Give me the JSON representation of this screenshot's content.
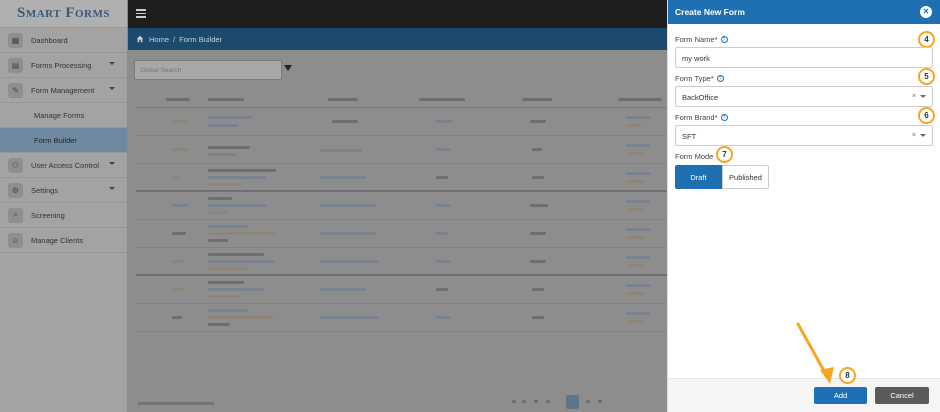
{
  "app": {
    "logo_text": "Smart Forms"
  },
  "sidebar": {
    "items": [
      {
        "label": "Dashboard",
        "icon": "dashboard-icon",
        "has_arrow": false
      },
      {
        "label": "Forms Processing",
        "icon": "forms-icon",
        "has_arrow": true
      },
      {
        "label": "Form Management",
        "icon": "edit-icon",
        "has_arrow": true
      },
      {
        "label": "Manage Forms",
        "sub": true
      },
      {
        "label": "Form Builder",
        "sub": true,
        "active": true
      },
      {
        "label": "User Access Control",
        "icon": "users-icon",
        "has_arrow": true
      },
      {
        "label": "Settings",
        "icon": "gear-icon",
        "has_arrow": true
      },
      {
        "label": "Screening",
        "icon": "search-icon",
        "has_arrow": false
      },
      {
        "label": "Manage Clients",
        "icon": "add-user-icon",
        "has_arrow": false
      }
    ]
  },
  "breadcrumb": {
    "home": "Home",
    "separator": "/",
    "current": "Form Builder"
  },
  "main": {
    "search_placeholder": "Global Search"
  },
  "panel": {
    "title": "Create New Form",
    "form_name": {
      "label": "Form Name*",
      "value": "my work",
      "step": "4"
    },
    "form_type": {
      "label": "Form Type*",
      "value": "BackOffice",
      "step": "5"
    },
    "form_brand": {
      "label": "Form Brand*",
      "value": "SFT",
      "step": "6"
    },
    "form_mode": {
      "label": "Form Mode",
      "step": "7",
      "draft": "Draft",
      "published": "Published"
    },
    "add_label": "Add",
    "cancel_label": "Cancel",
    "add_step": "8",
    "clear_glyph": "×"
  },
  "colors": {
    "accent": "#1f70b3",
    "step_ring": "#f6a623",
    "cancel": "#5b5b5b"
  }
}
